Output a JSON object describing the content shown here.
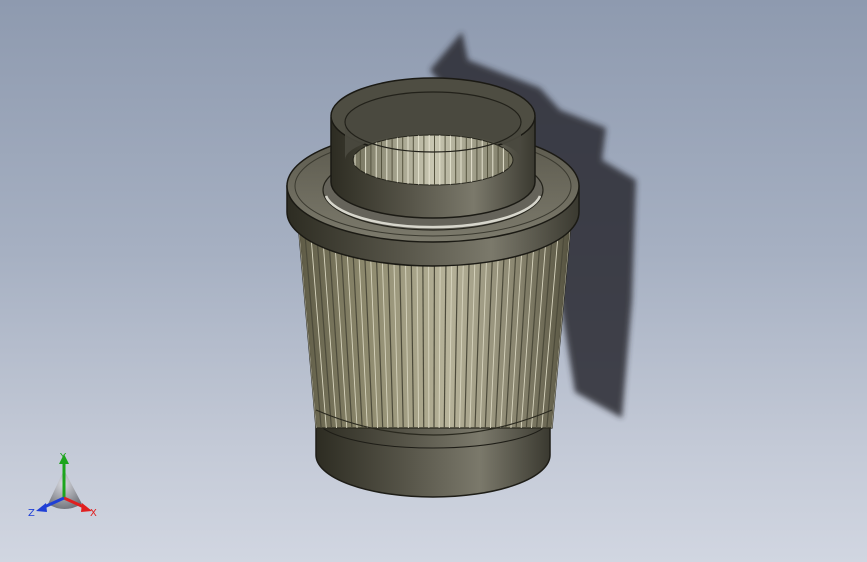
{
  "view": {
    "part": "filter-element",
    "background_top": "#8e9aaf",
    "background_bottom": "#d1d6e1"
  },
  "triad": {
    "x_label": "X",
    "y_label": "Y",
    "z_label": "Z",
    "x_color": "#e02020",
    "y_color": "#1ca51c",
    "z_color": "#1f3fd6"
  }
}
